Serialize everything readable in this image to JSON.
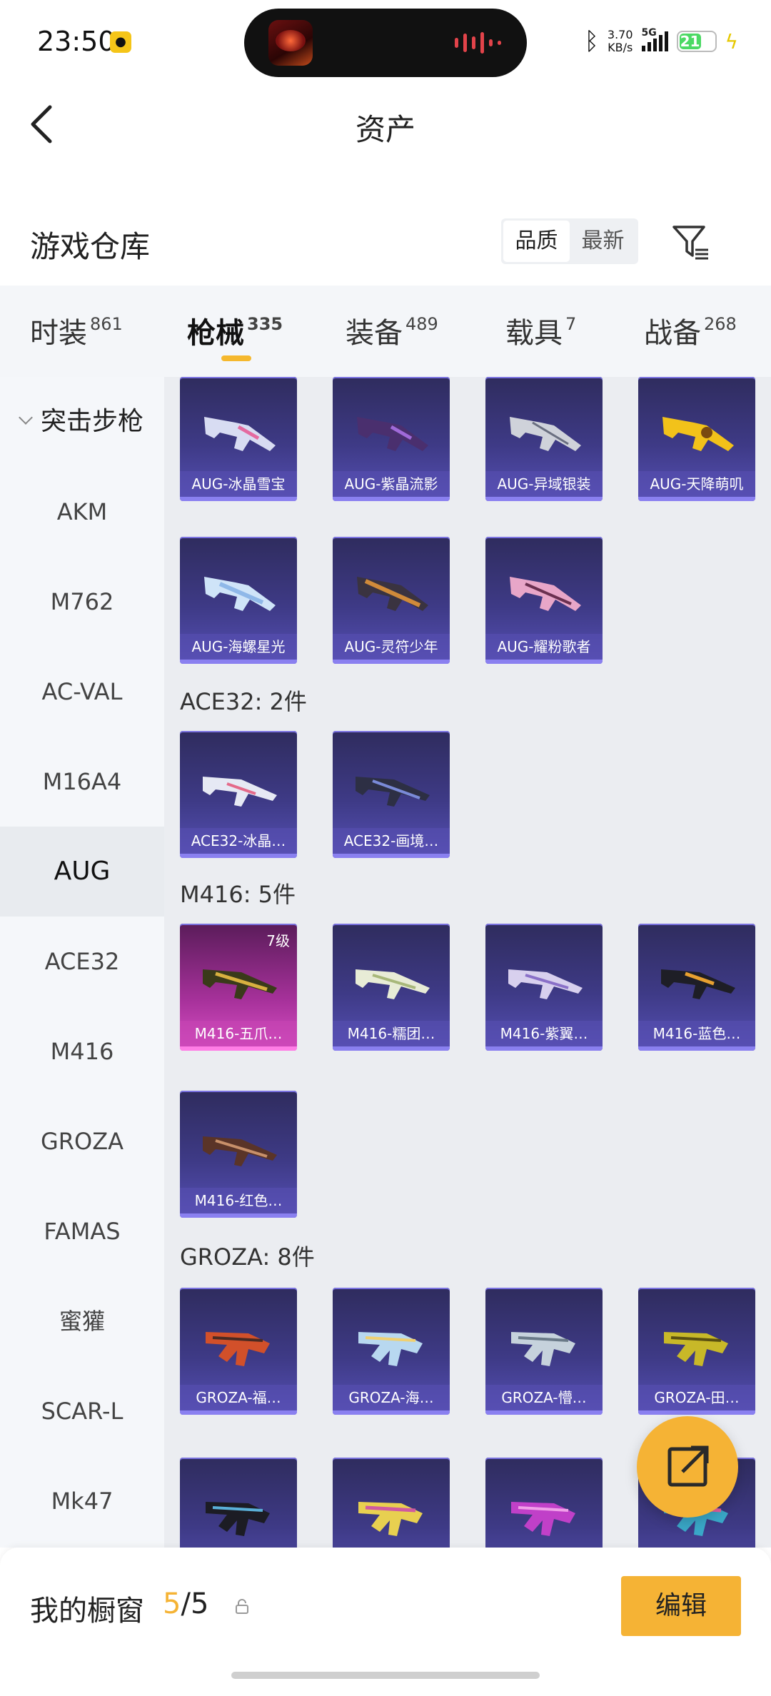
{
  "status": {
    "time": "23:50",
    "net_speed": "3.70",
    "net_unit": "KB/s",
    "network": "5G",
    "battery": "21"
  },
  "nav": {
    "title": "资产"
  },
  "warehouse": {
    "title": "游戏仓库",
    "sort_options": [
      "品质",
      "最新"
    ],
    "sort_selected": "品质"
  },
  "tabs": [
    {
      "label": "时装",
      "count": "861"
    },
    {
      "label": "枪械",
      "count": "335",
      "active": true
    },
    {
      "label": "装备",
      "count": "489"
    },
    {
      "label": "载具",
      "count": "7"
    },
    {
      "label": "战备",
      "count": "268"
    }
  ],
  "sidebar": {
    "category": "突击步枪",
    "items": [
      "AKM",
      "M762",
      "AC-VAL",
      "M16A4",
      "AUG",
      "ACE32",
      "M416",
      "GROZA",
      "FAMAS",
      "蜜獾",
      "SCAR-L",
      "Mk47"
    ],
    "selected": "AUG"
  },
  "groups": {
    "aug": {
      "items": [
        "AUG-冰晶雪宝",
        "AUG-紫晶流影",
        "AUG-异域银装",
        "AUG-天降萌叽",
        "AUG-海螺星光",
        "AUG-灵符少年",
        "AUG-耀粉歌者"
      ]
    },
    "ace32": {
      "title": "ACE32: 2件",
      "items": [
        "ACE32-冰晶…",
        "ACE32-画境…"
      ]
    },
    "m416": {
      "title": "M416: 5件",
      "items": [
        "M416-五爪…",
        "M416-糯团…",
        "M416-紫翼…",
        "M416-蓝色…",
        "M416-红色…"
      ],
      "level_badge": "7级"
    },
    "groza": {
      "title": "GROZA: 8件",
      "items": [
        "GROZA-福…",
        "GROZA-海…",
        "GROZA-懵…",
        "GROZA-田…"
      ]
    }
  },
  "showcase": {
    "title": "我的橱窗",
    "current": "5",
    "separator": "/",
    "total": "5",
    "edit_label": "编辑"
  },
  "colors": {
    "accent": "#f5b335",
    "card_dark": "#2f2c5e",
    "card_light": "#5650b5",
    "card_pink": "#d94fc5"
  }
}
